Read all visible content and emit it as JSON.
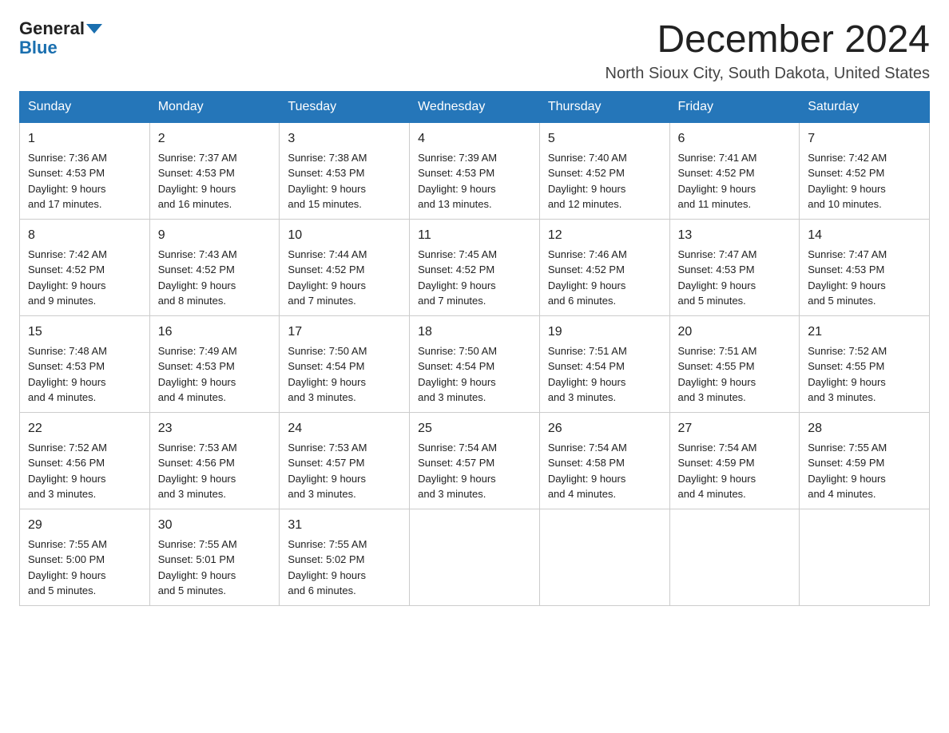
{
  "header": {
    "logo_general": "General",
    "logo_blue": "Blue",
    "month_title": "December 2024",
    "location": "North Sioux City, South Dakota, United States"
  },
  "days_of_week": [
    "Sunday",
    "Monday",
    "Tuesday",
    "Wednesday",
    "Thursday",
    "Friday",
    "Saturday"
  ],
  "weeks": [
    [
      {
        "day": "1",
        "sunrise": "7:36 AM",
        "sunset": "4:53 PM",
        "daylight": "9 hours and 17 minutes."
      },
      {
        "day": "2",
        "sunrise": "7:37 AM",
        "sunset": "4:53 PM",
        "daylight": "9 hours and 16 minutes."
      },
      {
        "day": "3",
        "sunrise": "7:38 AM",
        "sunset": "4:53 PM",
        "daylight": "9 hours and 15 minutes."
      },
      {
        "day": "4",
        "sunrise": "7:39 AM",
        "sunset": "4:53 PM",
        "daylight": "9 hours and 13 minutes."
      },
      {
        "day": "5",
        "sunrise": "7:40 AM",
        "sunset": "4:52 PM",
        "daylight": "9 hours and 12 minutes."
      },
      {
        "day": "6",
        "sunrise": "7:41 AM",
        "sunset": "4:52 PM",
        "daylight": "9 hours and 11 minutes."
      },
      {
        "day": "7",
        "sunrise": "7:42 AM",
        "sunset": "4:52 PM",
        "daylight": "9 hours and 10 minutes."
      }
    ],
    [
      {
        "day": "8",
        "sunrise": "7:42 AM",
        "sunset": "4:52 PM",
        "daylight": "9 hours and 9 minutes."
      },
      {
        "day": "9",
        "sunrise": "7:43 AM",
        "sunset": "4:52 PM",
        "daylight": "9 hours and 8 minutes."
      },
      {
        "day": "10",
        "sunrise": "7:44 AM",
        "sunset": "4:52 PM",
        "daylight": "9 hours and 7 minutes."
      },
      {
        "day": "11",
        "sunrise": "7:45 AM",
        "sunset": "4:52 PM",
        "daylight": "9 hours and 7 minutes."
      },
      {
        "day": "12",
        "sunrise": "7:46 AM",
        "sunset": "4:52 PM",
        "daylight": "9 hours and 6 minutes."
      },
      {
        "day": "13",
        "sunrise": "7:47 AM",
        "sunset": "4:53 PM",
        "daylight": "9 hours and 5 minutes."
      },
      {
        "day": "14",
        "sunrise": "7:47 AM",
        "sunset": "4:53 PM",
        "daylight": "9 hours and 5 minutes."
      }
    ],
    [
      {
        "day": "15",
        "sunrise": "7:48 AM",
        "sunset": "4:53 PM",
        "daylight": "9 hours and 4 minutes."
      },
      {
        "day": "16",
        "sunrise": "7:49 AM",
        "sunset": "4:53 PM",
        "daylight": "9 hours and 4 minutes."
      },
      {
        "day": "17",
        "sunrise": "7:50 AM",
        "sunset": "4:54 PM",
        "daylight": "9 hours and 3 minutes."
      },
      {
        "day": "18",
        "sunrise": "7:50 AM",
        "sunset": "4:54 PM",
        "daylight": "9 hours and 3 minutes."
      },
      {
        "day": "19",
        "sunrise": "7:51 AM",
        "sunset": "4:54 PM",
        "daylight": "9 hours and 3 minutes."
      },
      {
        "day": "20",
        "sunrise": "7:51 AM",
        "sunset": "4:55 PM",
        "daylight": "9 hours and 3 minutes."
      },
      {
        "day": "21",
        "sunrise": "7:52 AM",
        "sunset": "4:55 PM",
        "daylight": "9 hours and 3 minutes."
      }
    ],
    [
      {
        "day": "22",
        "sunrise": "7:52 AM",
        "sunset": "4:56 PM",
        "daylight": "9 hours and 3 minutes."
      },
      {
        "day": "23",
        "sunrise": "7:53 AM",
        "sunset": "4:56 PM",
        "daylight": "9 hours and 3 minutes."
      },
      {
        "day": "24",
        "sunrise": "7:53 AM",
        "sunset": "4:57 PM",
        "daylight": "9 hours and 3 minutes."
      },
      {
        "day": "25",
        "sunrise": "7:54 AM",
        "sunset": "4:57 PM",
        "daylight": "9 hours and 3 minutes."
      },
      {
        "day": "26",
        "sunrise": "7:54 AM",
        "sunset": "4:58 PM",
        "daylight": "9 hours and 4 minutes."
      },
      {
        "day": "27",
        "sunrise": "7:54 AM",
        "sunset": "4:59 PM",
        "daylight": "9 hours and 4 minutes."
      },
      {
        "day": "28",
        "sunrise": "7:55 AM",
        "sunset": "4:59 PM",
        "daylight": "9 hours and 4 minutes."
      }
    ],
    [
      {
        "day": "29",
        "sunrise": "7:55 AM",
        "sunset": "5:00 PM",
        "daylight": "9 hours and 5 minutes."
      },
      {
        "day": "30",
        "sunrise": "7:55 AM",
        "sunset": "5:01 PM",
        "daylight": "9 hours and 5 minutes."
      },
      {
        "day": "31",
        "sunrise": "7:55 AM",
        "sunset": "5:02 PM",
        "daylight": "9 hours and 6 minutes."
      },
      null,
      null,
      null,
      null
    ]
  ],
  "labels": {
    "sunrise": "Sunrise:",
    "sunset": "Sunset:",
    "daylight": "Daylight:"
  }
}
